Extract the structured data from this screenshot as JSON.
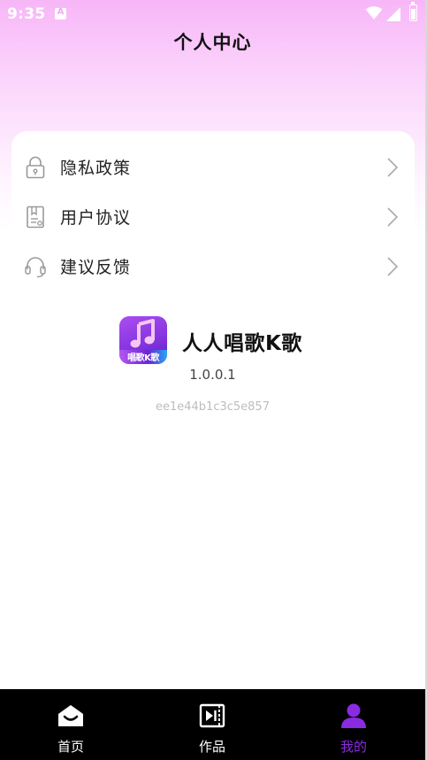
{
  "status_bar": {
    "time": "9:35",
    "notification_letter": "A"
  },
  "header": {
    "title": "个人中心"
  },
  "menu": {
    "items": [
      {
        "label": "隐私政策",
        "icon": "lock-icon"
      },
      {
        "label": "用户协议",
        "icon": "document-icon"
      },
      {
        "label": "建议反馈",
        "icon": "headset-icon"
      }
    ]
  },
  "about": {
    "app_name": "人人唱歌K歌",
    "logo_text": "唱歌K歌",
    "version": "1.0.0.1",
    "device_id": "ee1e44b1c3c5e857"
  },
  "tabs": [
    {
      "label": "首页",
      "icon": "home-icon",
      "active": false
    },
    {
      "label": "作品",
      "icon": "video-icon",
      "active": false
    },
    {
      "label": "我的",
      "icon": "user-icon",
      "active": true
    }
  ],
  "colors": {
    "accent": "#8a2be2",
    "header_gradient_top": "#f7b6f7",
    "tab_bar": "#000000"
  }
}
